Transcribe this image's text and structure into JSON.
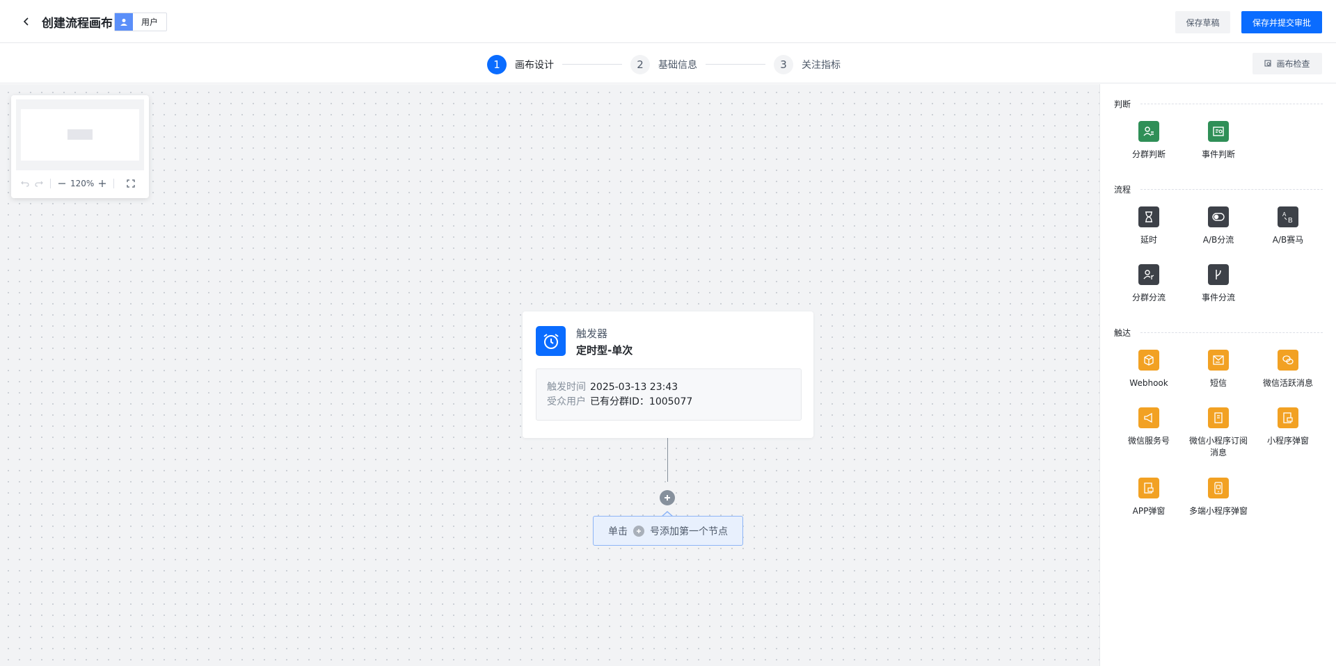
{
  "header": {
    "title": "创建流程画布",
    "tag_label": "用户",
    "save_draft": "保存草稿",
    "save_submit": "保存并提交审批"
  },
  "steps": [
    {
      "num": "1",
      "label": "画布设计",
      "active": true
    },
    {
      "num": "2",
      "label": "基础信息",
      "active": false
    },
    {
      "num": "3",
      "label": "关注指标",
      "active": false
    }
  ],
  "canvas_check": "画布检查",
  "minimap": {
    "zoom": "120%"
  },
  "trigger_node": {
    "type": "触发器",
    "name": "定时型-单次",
    "time_label": "触发时间",
    "time_value": "2025-03-13 23:43",
    "audience_label": "受众用户",
    "audience_value": "已有分群ID：1005077"
  },
  "hint": {
    "before": "单击",
    "after": "号添加第一个节点"
  },
  "panel": {
    "judge": {
      "title": "判断",
      "items": [
        {
          "label": "分群判断",
          "icon": "segment-judge-icon"
        },
        {
          "label": "事件判断",
          "icon": "event-judge-icon"
        }
      ]
    },
    "flow": {
      "title": "流程",
      "items": [
        {
          "label": "延时",
          "icon": "hourglass-icon"
        },
        {
          "label": "A/B分流",
          "icon": "toggle-icon"
        },
        {
          "label": "A/B赛马",
          "icon": "ab-icon"
        },
        {
          "label": "分群分流",
          "icon": "segment-split-icon"
        },
        {
          "label": "事件分流",
          "icon": "branch-icon"
        }
      ]
    },
    "reach": {
      "title": "触达",
      "items": [
        {
          "label": "Webhook",
          "icon": "cube-icon"
        },
        {
          "label": "短信",
          "icon": "sms-icon"
        },
        {
          "label": "微信活跃消息",
          "icon": "wechat-icon"
        },
        {
          "label": "微信服务号",
          "icon": "megaphone-icon"
        },
        {
          "label": "微信小程序订阅消息",
          "icon": "document-icon"
        },
        {
          "label": "小程序弹窗",
          "icon": "mini-popup-icon"
        },
        {
          "label": "APP弹窗",
          "icon": "app-popup-icon"
        },
        {
          "label": "多端小程序弹窗",
          "icon": "phone-icon"
        }
      ]
    }
  },
  "colors": {
    "primary": "#0a6cff",
    "judge": "#2f8f57",
    "flow": "#3d4148",
    "reach": "#f2a123"
  }
}
